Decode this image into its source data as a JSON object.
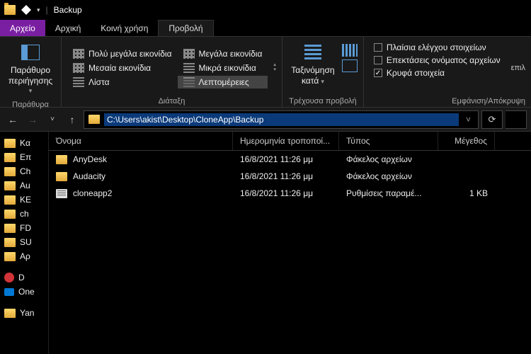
{
  "title": "Backup",
  "tabs": {
    "file": "Αρχείο",
    "home": "Αρχική",
    "share": "Κοινή χρήση",
    "view": "Προβολή"
  },
  "ribbon": {
    "nav_pane": "Παράθυρο περιήγησης",
    "group_panes": "Παράθυρα",
    "layouts": {
      "xl": "Πολύ μεγάλα εικονίδια",
      "lg": "Μεγάλα εικονίδια",
      "md": "Μεσαία εικονίδια",
      "sm": "Μικρά εικονίδια",
      "list": "Λίστα",
      "details": "Λεπτομέρειες"
    },
    "group_layout": "Διάταξη",
    "sort": "Ταξινόμηση κατά",
    "group_current": "Τρέχουσα προβολή",
    "checks": {
      "item_checkboxes": "Πλαίσια ελέγχου στοιχείων",
      "extensions": "Επεκτάσεις ονόματος αρχείων",
      "hidden": "Κρυφά στοιχεία"
    },
    "options": "επιλ",
    "group_showhide": "Εμφάνιση/Απόκρυψη"
  },
  "address": "C:\\Users\\akist\\Desktop\\CloneApp\\Backup",
  "columns": {
    "name": "Όνομα",
    "date": "Ημερομηνία τροποποί...",
    "type": "Τύπος",
    "size": "Μέγεθος"
  },
  "sidebar": [
    "Kα",
    "Επ",
    "Ch",
    "Au",
    "KE",
    "ch",
    "FD",
    "SU",
    "Αρ",
    "D",
    "One",
    "Yan"
  ],
  "rows": [
    {
      "icon": "folder",
      "name": "AnyDesk",
      "date": "16/8/2021 11:26 μμ",
      "type": "Φάκελος αρχείων",
      "size": ""
    },
    {
      "icon": "folder",
      "name": "Audacity",
      "date": "16/8/2021 11:26 μμ",
      "type": "Φάκελος αρχείων",
      "size": ""
    },
    {
      "icon": "file",
      "name": "cloneapp2",
      "date": "16/8/2021 11:26 μμ",
      "type": "Ρυθμίσεις παραμέ...",
      "size": "1 KB"
    }
  ]
}
